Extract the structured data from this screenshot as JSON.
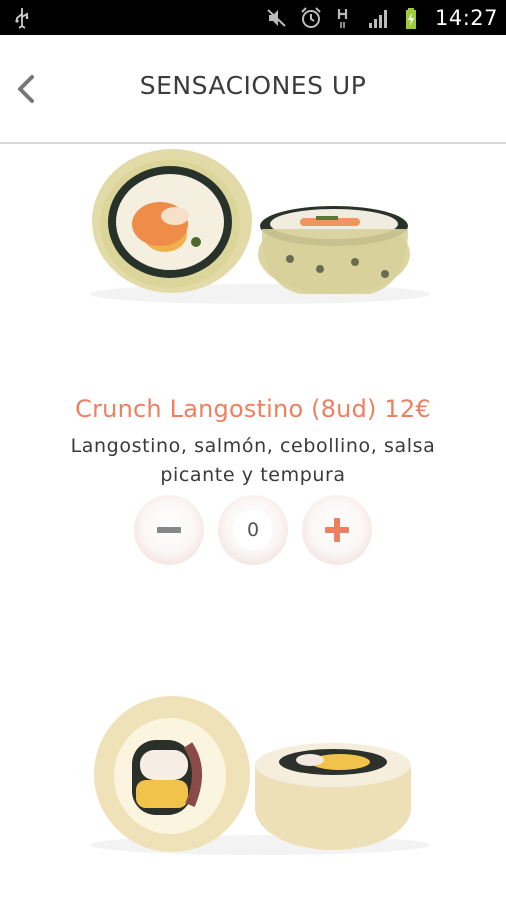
{
  "status_bar": {
    "time": "14:27",
    "icons": [
      "usb-icon",
      "mute-icon",
      "alarm-icon",
      "hspa-icon",
      "signal-icon",
      "battery-charging-icon"
    ]
  },
  "header": {
    "title": "SENSACIONES UP",
    "back_icon": "chevron-left-icon"
  },
  "product": {
    "name": "Crunch Langostino (8ud) 12€",
    "description": "Langostino, salmón, cebollino, salsa picante y tempura",
    "quantity": "0",
    "decrease_icon": "minus-icon",
    "increase_icon": "plus-icon"
  },
  "colors": {
    "accent": "#ee7f5f",
    "text": "#3a3a3a",
    "divider": "#d9d9d9"
  }
}
